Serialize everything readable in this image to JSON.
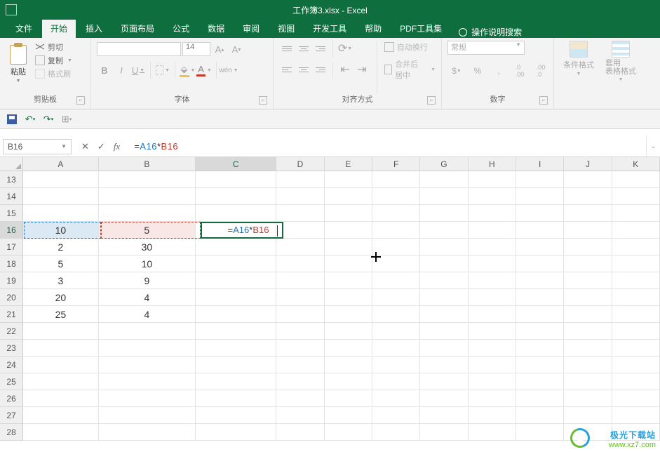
{
  "app": {
    "title": "工作簿3.xlsx  -  Excel"
  },
  "tabs": {
    "file": "文件",
    "home": "开始",
    "insert": "插入",
    "pageLayout": "页面布局",
    "formulas": "公式",
    "data": "数据",
    "review": "审阅",
    "view": "视图",
    "developer": "开发工具",
    "help": "帮助",
    "pdfTools": "PDF工具集",
    "tellMe": "操作说明搜索"
  },
  "ribbon": {
    "clipboard": {
      "label": "剪贴板",
      "paste": "粘贴",
      "cut": "剪切",
      "copy": "复制",
      "formatPainter": "格式刷"
    },
    "font": {
      "label": "字体",
      "size": "14",
      "bold": "B",
      "italic": "I",
      "underline": "U",
      "phonetic": "wén"
    },
    "alignment": {
      "label": "对齐方式",
      "wrap": "自动换行",
      "merge": "合并后居中"
    },
    "number": {
      "label": "数字",
      "format": "常规",
      "percent": "%",
      "comma": ",",
      "inc": ".0",
      "dec": ".00"
    },
    "styles": {
      "label": "",
      "cond": "条件格式",
      "tableFmt": "套用\n表格格式"
    }
  },
  "namebox": "B16",
  "formula": {
    "prefix": "=",
    "ref1": "A16",
    "op": "*",
    "ref2": "B16"
  },
  "columns": [
    "A",
    "B",
    "C",
    "D",
    "E",
    "F",
    "G",
    "H",
    "I",
    "J",
    "K"
  ],
  "rowStart": 13,
  "rows": [
    {
      "n": 13,
      "A": "",
      "B": "",
      "C": ""
    },
    {
      "n": 14,
      "A": "",
      "B": "",
      "C": ""
    },
    {
      "n": 15,
      "A": "",
      "B": "",
      "C": ""
    },
    {
      "n": 16,
      "A": "10",
      "B": "5",
      "C_formula": true
    },
    {
      "n": 17,
      "A": "2",
      "B": "30",
      "C": ""
    },
    {
      "n": 18,
      "A": "5",
      "B": "10",
      "C": ""
    },
    {
      "n": 19,
      "A": "3",
      "B": "9",
      "C": ""
    },
    {
      "n": 20,
      "A": "20",
      "B": "4",
      "C": ""
    },
    {
      "n": 21,
      "A": "25",
      "B": "4",
      "C": ""
    },
    {
      "n": 22,
      "A": "",
      "B": "",
      "C": ""
    },
    {
      "n": 23,
      "A": "",
      "B": "",
      "C": ""
    },
    {
      "n": 24,
      "A": "",
      "B": "",
      "C": ""
    },
    {
      "n": 25,
      "A": "",
      "B": "",
      "C": ""
    },
    {
      "n": 26,
      "A": "",
      "B": "",
      "C": ""
    },
    {
      "n": 27,
      "A": "",
      "B": "",
      "C": ""
    },
    {
      "n": 28,
      "A": "",
      "B": "",
      "C": ""
    }
  ],
  "watermark": {
    "line1": "极光下载站",
    "line2": "www.xz7.com"
  }
}
